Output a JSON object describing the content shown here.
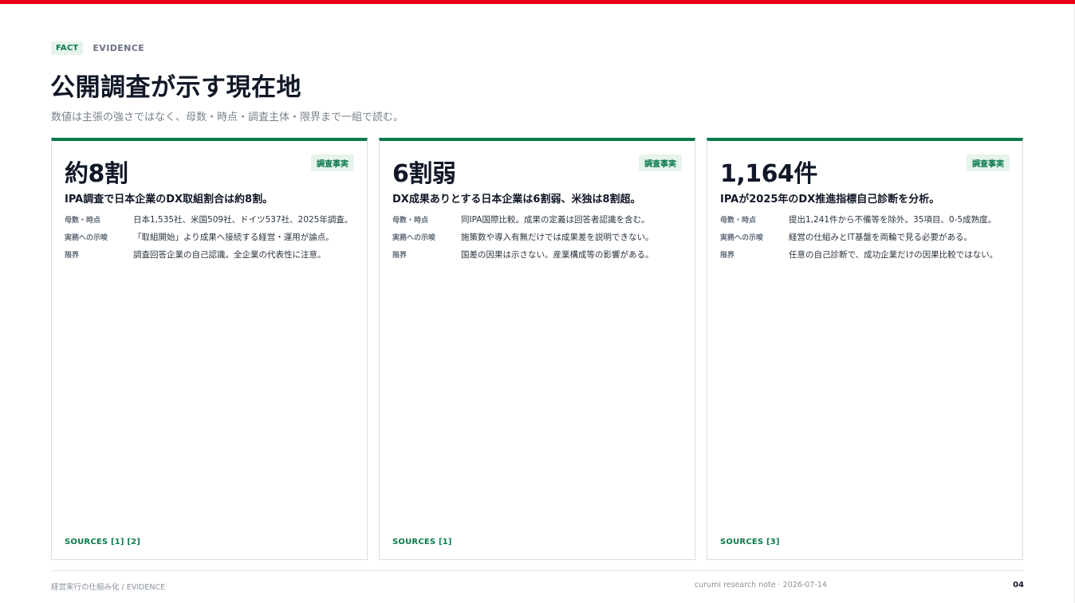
{
  "header": {
    "fact_tag": "FACT",
    "evidence_label": "EVIDENCE",
    "title": "公開調査が示す現在地",
    "subtitle": "数値は主張の強さではなく、母数・時点・調査主体・限界まで一組で読む。"
  },
  "colors": {
    "accent_red": "#e60012",
    "accent_green": "#0b7a4b"
  },
  "cards": [
    {
      "metric": "約8割",
      "badge": "調査事実",
      "headline": "IPA調査で日本企業のDX取組割合は約8割。",
      "rows": [
        {
          "label": "母数・時点",
          "value": "日本1,535社、米国509社、ドイツ537社、2025年調査。"
        },
        {
          "label": "実務への示唆",
          "value": "「取組開始」より成果へ接続する経営・運用が論点。"
        },
        {
          "label": "限界",
          "value": "調査回答企業の自己認識。全企業の代表性に注意。"
        }
      ],
      "sources": "SOURCES [1] [2]"
    },
    {
      "metric": "6割弱",
      "badge": "調査事実",
      "headline": "DX成果ありとする日本企業は6割弱、米独は8割超。",
      "rows": [
        {
          "label": "母数・時点",
          "value": "同IPA国際比較。成果の定義は回答者認識を含む。"
        },
        {
          "label": "実務への示唆",
          "value": "施策数や導入有無だけでは成果差を説明できない。"
        },
        {
          "label": "限界",
          "value": "国差の因果は示さない。産業構成等の影響がある。"
        }
      ],
      "sources": "SOURCES [1]"
    },
    {
      "metric": "1,164件",
      "badge": "調査事実",
      "headline": "IPAが2025年のDX推進指標自己診断を分析。",
      "rows": [
        {
          "label": "母数・時点",
          "value": "提出1,241件から不備等を除外。35項目、0-5成熟度。"
        },
        {
          "label": "実務への示唆",
          "value": "経営の仕組みとIT基盤を両輪で見る必要がある。"
        },
        {
          "label": "限界",
          "value": "任意の自己診断で、成功企業だけの因果比較ではない。"
        }
      ],
      "sources": "SOURCES [3]"
    }
  ],
  "footer": {
    "left": "経営実行の仕組み化 / EVIDENCE",
    "center": "curumi research note · 2026-07-14",
    "page": "04"
  }
}
